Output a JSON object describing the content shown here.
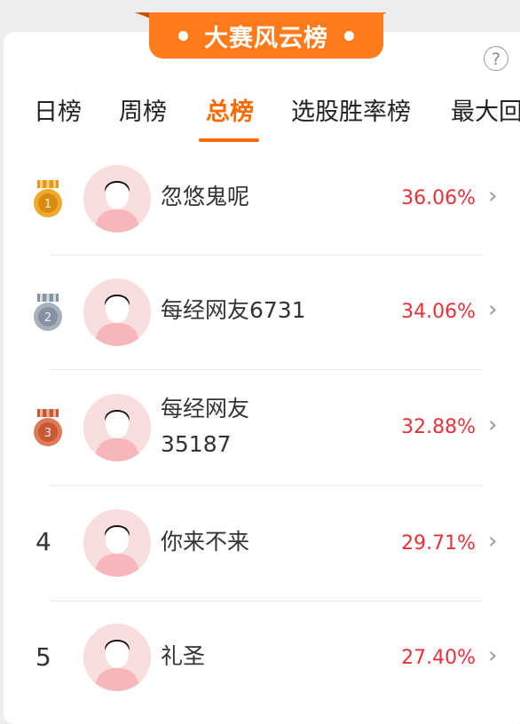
{
  "banner": {
    "title": "大赛风云榜"
  },
  "help_label": "?",
  "tabs": [
    {
      "label": "日榜"
    },
    {
      "label": "周榜"
    },
    {
      "label": "总榜"
    },
    {
      "label": "选股胜率榜"
    },
    {
      "label": "最大回"
    }
  ],
  "active_tab": "总榜",
  "rows": [
    {
      "rank": "1",
      "name": "忽悠鬼呢",
      "rate": "36.06%",
      "medal": "gold"
    },
    {
      "rank": "2",
      "name": "每经网友6731",
      "rate": "34.06%",
      "medal": "silver"
    },
    {
      "rank": "3",
      "name_line1": "每经网友",
      "name_line2": "35187",
      "rate": "32.88%",
      "medal": "bronze"
    },
    {
      "rank": "4",
      "name": "你来不来",
      "rate": "29.71%"
    },
    {
      "rank": "5",
      "name": "礼圣",
      "rate": "27.40%"
    }
  ],
  "colors": {
    "accent": "#ff7a1a",
    "active_tab": "#ff6a00",
    "rate": "#e8323a",
    "gold": "#f0a92a",
    "silver": "#a8b0bd",
    "bronze": "#e07a55"
  },
  "icons": {
    "medal": "medal-icon",
    "avatar": "avatar-icon",
    "chevron": "chevron-right-icon",
    "help": "help-circle-icon"
  }
}
